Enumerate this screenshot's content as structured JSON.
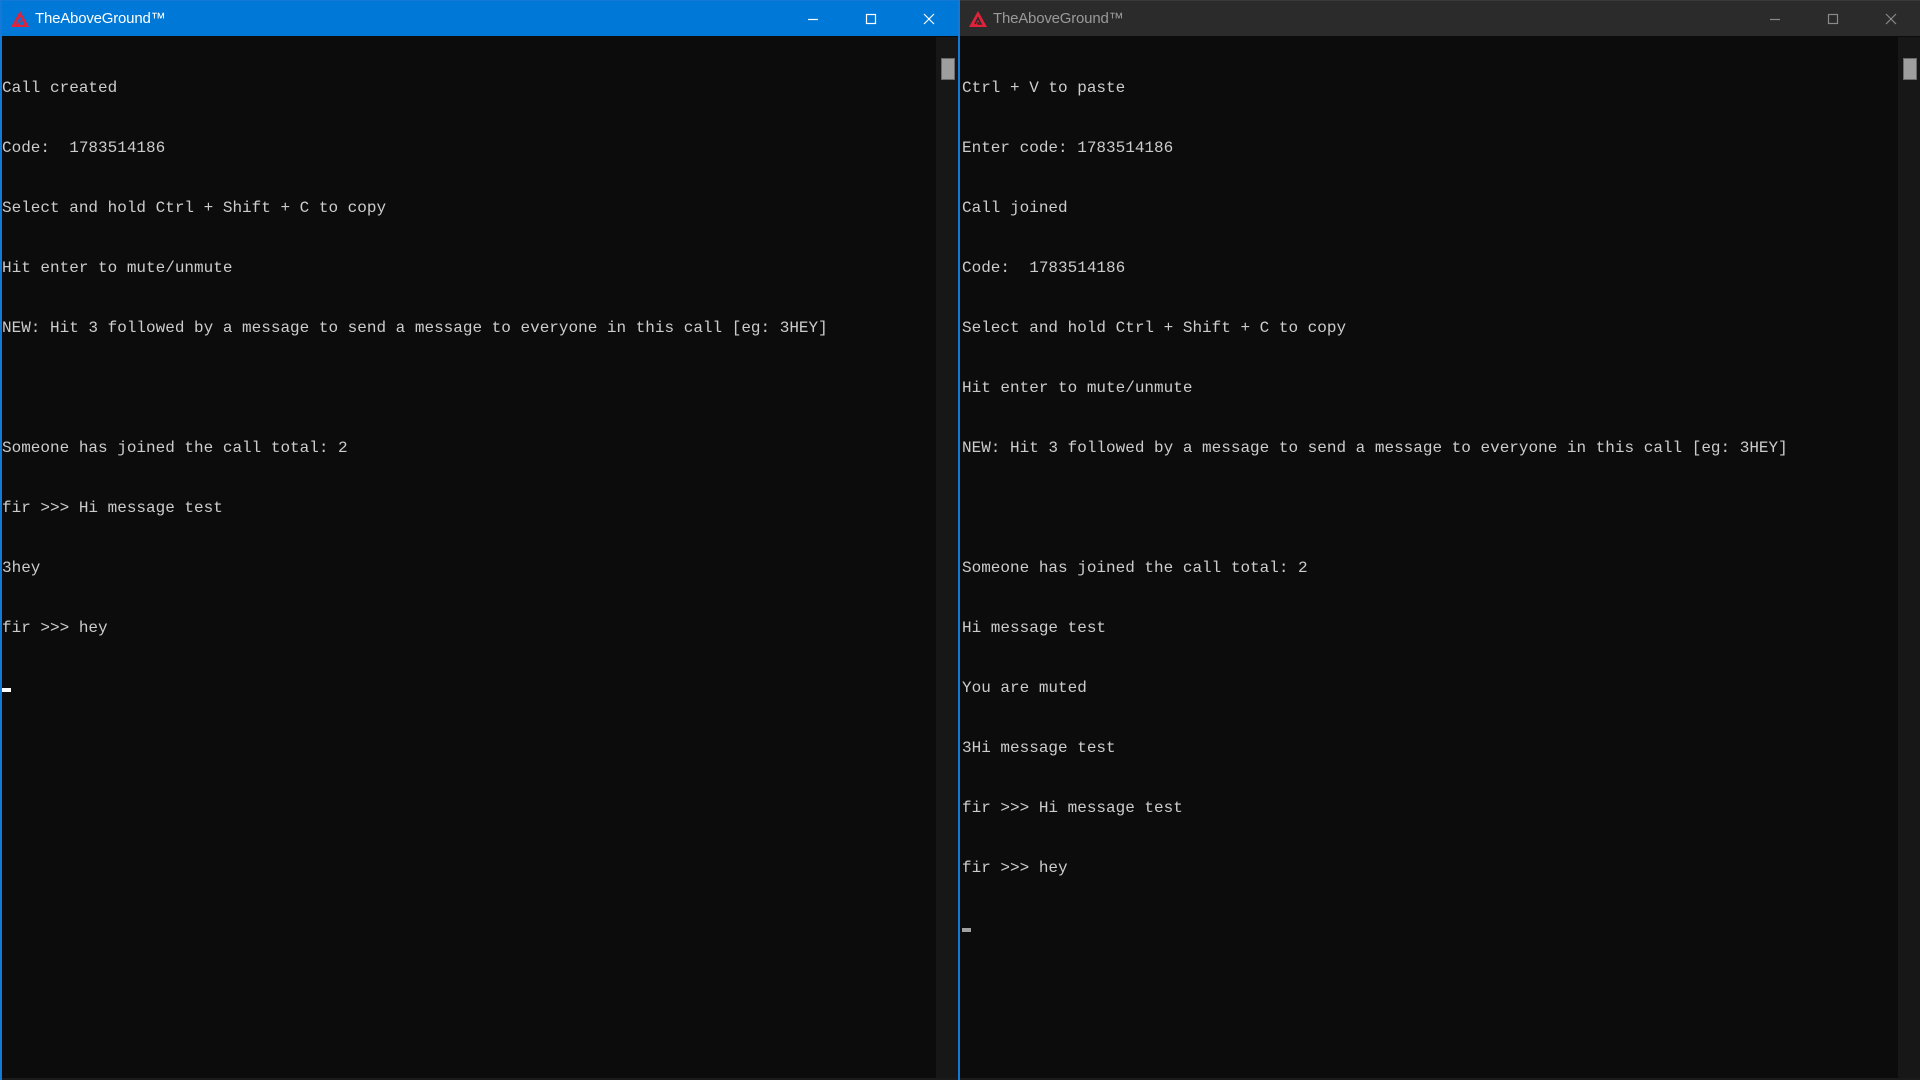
{
  "windows": [
    {
      "id": "left",
      "title": "TheAboveGround™",
      "focused": true,
      "titlebar_color": "#0078d7",
      "controls": {
        "minimize": "minimize-icon",
        "maximize": "maximize-icon",
        "close": "close-icon"
      },
      "lines": [
        "Call created",
        "Code:  1783514186",
        "Select and hold Ctrl + Shift + C to copy",
        "Hit enter to mute/unmute",
        "NEW: Hit 3 followed by a message to send a message to everyone in this call [eg: 3HEY]",
        "",
        "Someone has joined the call total: 2",
        "fir >>> Hi message test",
        "3hey",
        "fir >>> hey",
        ""
      ]
    },
    {
      "id": "right",
      "title": "TheAboveGround™",
      "focused": false,
      "titlebar_color": "#2b2b2b",
      "controls": {
        "minimize": "minimize-icon",
        "maximize": "maximize-icon",
        "close": "close-icon"
      },
      "lines": [
        "Ctrl + V to paste",
        "Enter code: 1783514186",
        "Call joined",
        "Code:  1783514186",
        "Select and hold Ctrl + Shift + C to copy",
        "Hit enter to mute/unmute",
        "NEW: Hit 3 followed by a message to send a message to everyone in this call [eg: 3HEY]",
        "",
        "Someone has joined the call total: 2",
        "Hi message test",
        "You are muted",
        "3Hi message test",
        "fir >>> Hi message test",
        "fir >>> hey",
        ""
      ]
    }
  ],
  "colors": {
    "console_bg": "#0c0c0c",
    "console_text": "#cccccc",
    "logo_red": "#e0233b",
    "active_accent": "#0078d7"
  }
}
